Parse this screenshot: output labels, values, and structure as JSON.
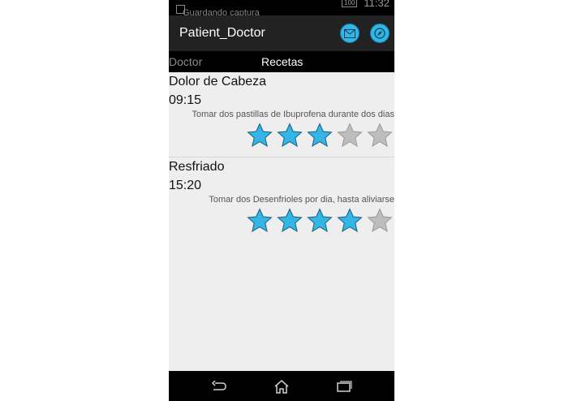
{
  "status_bar": {
    "notification_text": "Guardando captura",
    "battery": "100",
    "time": "11:32"
  },
  "action_bar": {
    "title": "Patient_Doctor",
    "icons": [
      "mail-icon",
      "compass-icon"
    ],
    "accent_color": "#33b5e5"
  },
  "tabs": [
    {
      "label": "Doctor",
      "selected": false
    },
    {
      "label": "Recetas",
      "selected": true
    }
  ],
  "prescriptions": [
    {
      "name": "Dolor de Cabeza",
      "time": "09:15",
      "description": "Tomar dos pastillas de Ibuprofena durante dos dias",
      "rating": 3,
      "max_rating": 5
    },
    {
      "name": "Resfriado",
      "time": "15:20",
      "description": "Tomar dos Desenfrioles por dia, hasta aliviarse",
      "rating": 4,
      "max_rating": 5
    }
  ],
  "nav_bar": [
    "back-icon",
    "home-icon",
    "recent-apps-icon"
  ],
  "colors": {
    "star_filled": "#33b5e5",
    "star_empty": "#bdbdbd"
  }
}
